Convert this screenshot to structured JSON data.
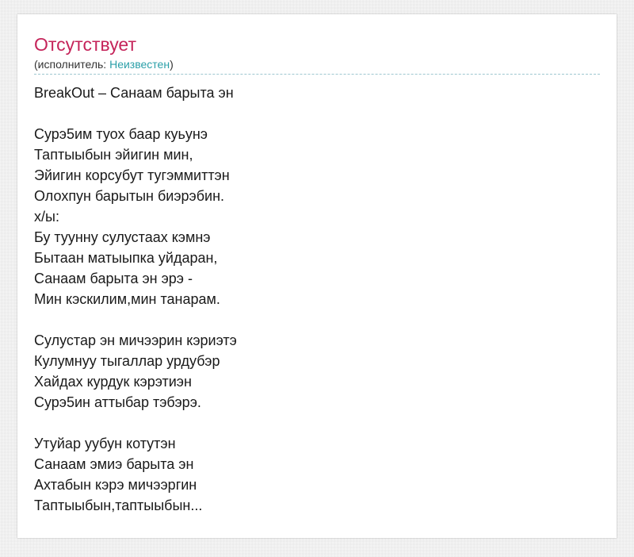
{
  "song": {
    "title": "Отсутствует",
    "artist_prefix": "(исполнитель: ",
    "artist_name": "Неизвестен",
    "artist_suffix": ")"
  },
  "lyrics_text": "BreakOut – Санаам барыта эн\n\nСурэ5им туох баар куьунэ\nТаптыыбын эйигин мин,\nЭйигин корсубут тугэммиттэн\nОлохпун барытын биэрэбин.\nх/ы:\nБу туунну сулустаах кэмнэ\nБытаан матыыпка уйдаран,\nСанаам барыта эн эрэ -\nМин кэскилим,мин танарам.\n\nСулустар эн мичээрин кэриэтэ\nКулумнуу тыгаллар урдубэр\nХайдах курдук кэрэтиэн\nСурэ5ин аттыбар тэбэрэ.\n\nУтуйар уубун котутэн\nСанаам эмиэ барыта эн\nАхтабын кэрэ мичээргин\nТаптыыбын,таптыыбын...",
  "colors": {
    "title": "#c5245a",
    "link": "#2a9fa8",
    "divider": "#9ec7d0"
  }
}
